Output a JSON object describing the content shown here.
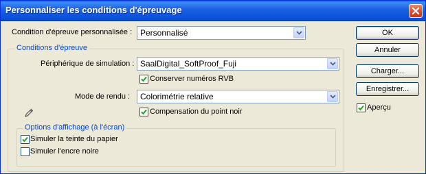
{
  "window": {
    "title": "Personnaliser les conditions d'épreuvage"
  },
  "condition": {
    "label": "Condition d'épreuve personnalisée :",
    "value": "Personnalisé"
  },
  "proof_group": {
    "legend": "Conditions d'épreuve",
    "device_label": "Périphérique de simulation :",
    "device_value": "SaalDigital_SoftProof_Fuji",
    "preserve_rgb_label": "Conserver numéros RVB",
    "preserve_rgb_checked": true,
    "intent_label": "Mode de rendu :",
    "intent_value": "Colorimétrie relative",
    "bpc_label": "Compensation du point noir",
    "bpc_checked": true
  },
  "display_group": {
    "legend": "Options d'affichage (à l'écran)",
    "paper_label": "Simuler la teinte du papier",
    "paper_checked": true,
    "ink_label": "Simuler l'encre noire",
    "ink_checked": false
  },
  "buttons": {
    "ok": "OK",
    "cancel": "Annuler",
    "load": "Charger...",
    "save": "Enregistrer..."
  },
  "preview": {
    "label": "Aperçu",
    "checked": true
  }
}
